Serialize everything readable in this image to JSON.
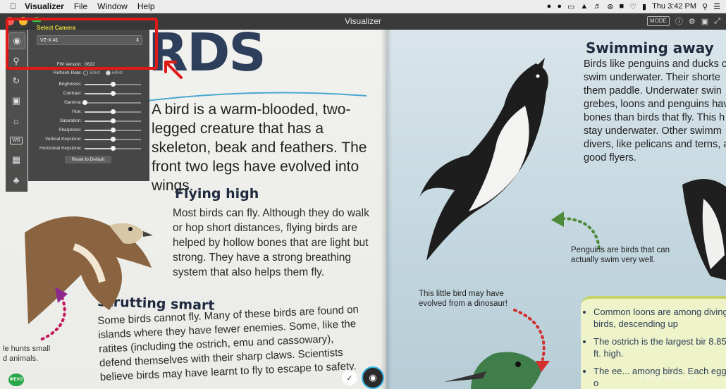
{
  "menubar": {
    "apple": "",
    "app_name": "Visualizer",
    "items": [
      "File",
      "Window",
      "Help"
    ],
    "clock": "Thu 3:42 PM"
  },
  "window": {
    "title": "Visualizer",
    "mode_badge": "MODE"
  },
  "camera_panel": {
    "title": "Select Camera",
    "selected_camera": "VZ-X #1",
    "fw_label": "FW Version:",
    "fw_value": "0622",
    "refresh_label": "Refresh Rate:",
    "refresh_options": [
      "50Hz",
      "60Hz"
    ],
    "refresh_selected": "60Hz",
    "sliders": [
      {
        "label": "Brightness:",
        "value": 0.5
      },
      {
        "label": "Contrast:",
        "value": 0.5
      },
      {
        "label": "Gamma:",
        "value": 0.0
      },
      {
        "label": "Hue:",
        "value": 0.5
      },
      {
        "label": "Saturation:",
        "value": 0.5
      },
      {
        "label": "Sharpness:",
        "value": 0.5
      },
      {
        "label": "Vertical Keystone:",
        "value": 0.5
      },
      {
        "label": "Horizontal Keystone:",
        "value": 0.5
      }
    ],
    "reset_label": "Reset to Default"
  },
  "toolbar": {
    "tools": [
      "camera-icon",
      "zoom-icon",
      "rotate-icon",
      "crop-icon",
      "exposure-icon",
      "white-balance-icon",
      "capture-settings-icon",
      "effects-icon"
    ],
    "wb_text": "WB"
  },
  "book": {
    "title": "RDS",
    "intro": "A bird is a warm-blooded, two-legged creature that has a skeleton, beak and feathers. The front two legs have evolved into wings.",
    "flying_heading": "Flying high",
    "flying_text": "Most birds can fly. Although they do walk or hop short distances, flying birds are helped by hollow bones that are light but strong. They have a strong breathing system that also helps them fly.",
    "strutting_heading": "Strutting smart",
    "strutting_text": "Some birds cannot fly. Many of these birds are found on islands where they have fewer enemies. Some, like the ratites (including the ostrich, emu and cassowary), defend themselves with their sharp claws. Scientists believe birds may have learnt to fly to escape to safety.",
    "hunts_caption": "le hunts small\nd animals.",
    "swimming_heading": "Swimming away",
    "swimming_lines": [
      "Birds like penguins and ducks c",
      "swim underwater. Their shorte",
      "them paddle. Underwater swin",
      "grebes, loons and penguins hav",
      "bones than birds that fly. This h",
      "stay underwater. Other swimm",
      "divers, like pelicans and terns, a",
      "good flyers."
    ],
    "penguin_caption": "Penguins are birds that can actually swim very well.",
    "dino_caption": "This little bird may have evolved from a dinosaur!",
    "facts": [
      "Common loons are among divings birds, descending up",
      "The ostrich is the largest bir 8.85 ft. high.",
      "The ee... among birds. Each egg is o"
    ]
  },
  "bottom": {
    "check_icon": "✓",
    "ipevo_label": "IPEVO",
    "watermark": "(ⓐⓐⓐⓐⓐ)"
  },
  "colors": {
    "highlight": "#e01818",
    "panel_title": "#e8dc3a",
    "capture_ring": "#35b5e8",
    "ipevo": "#29a64a"
  }
}
